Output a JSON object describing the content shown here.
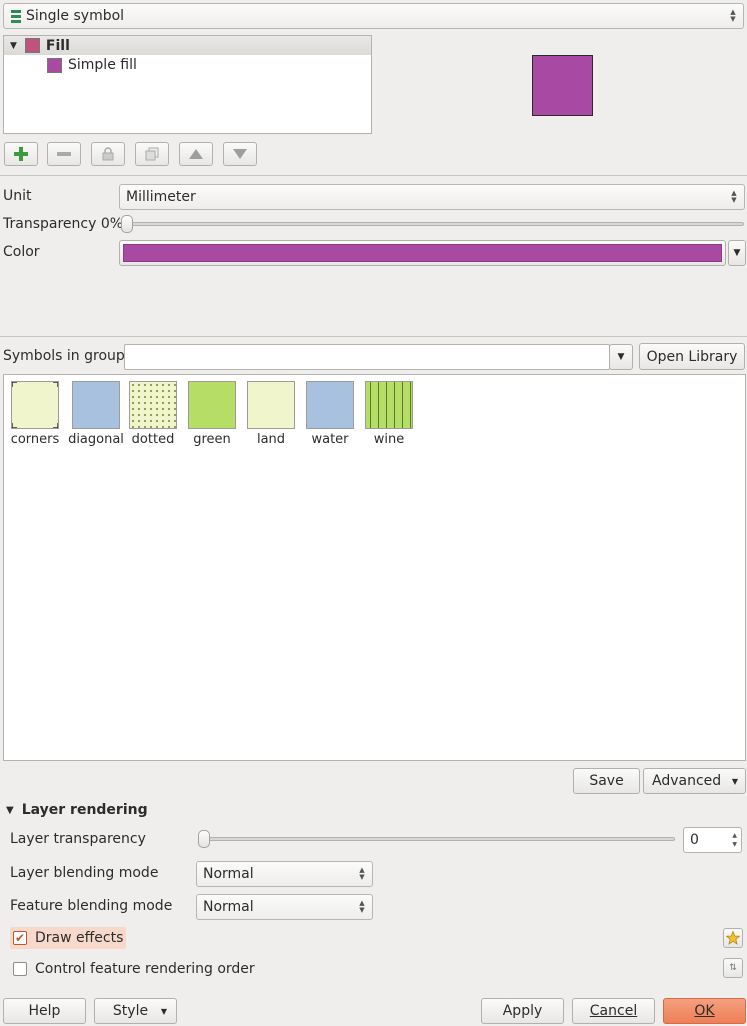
{
  "renderer": {
    "label": "Single symbol"
  },
  "tree": {
    "root_label": "Fill",
    "child_label": "Simple fill",
    "fill_color": "#a84aa4",
    "root_icon_color": "#c0527e"
  },
  "toolbar": {
    "add": "+",
    "remove": "−"
  },
  "unit": {
    "label": "Unit",
    "value": "Millimeter"
  },
  "transparency": {
    "label": "Transparency 0%",
    "value_percent": 0
  },
  "color": {
    "label": "Color",
    "value": "#a84aa4"
  },
  "symbols": {
    "label": "Symbols in group",
    "group_value": "",
    "open_library": "Open Library",
    "items": [
      {
        "name": "corners",
        "color": "#f1f5cc"
      },
      {
        "name": "diagonal",
        "color": "#a7c1df"
      },
      {
        "name": "dotted",
        "color": "#f1f5cc"
      },
      {
        "name": "green",
        "color": "#b6de67"
      },
      {
        "name": "land",
        "color": "#f1f5cc"
      },
      {
        "name": "water",
        "color": "#a7c1df"
      },
      {
        "name": "wine",
        "color": "#b6de67"
      }
    ]
  },
  "actions": {
    "save": "Save",
    "advanced": "Advanced"
  },
  "layer_rendering": {
    "title": "Layer rendering",
    "transparency_label": "Layer transparency",
    "transparency_value": "0",
    "layer_blend_label": "Layer blending mode",
    "layer_blend_value": "Normal",
    "feature_blend_label": "Feature blending mode",
    "feature_blend_value": "Normal",
    "draw_effects_label": "Draw effects",
    "draw_effects_checked": true,
    "control_order_label": "Control feature rendering order",
    "control_order_checked": false
  },
  "footer": {
    "help": "Help",
    "style": "Style",
    "apply": "Apply",
    "cancel": "Cancel",
    "ok": "OK"
  }
}
